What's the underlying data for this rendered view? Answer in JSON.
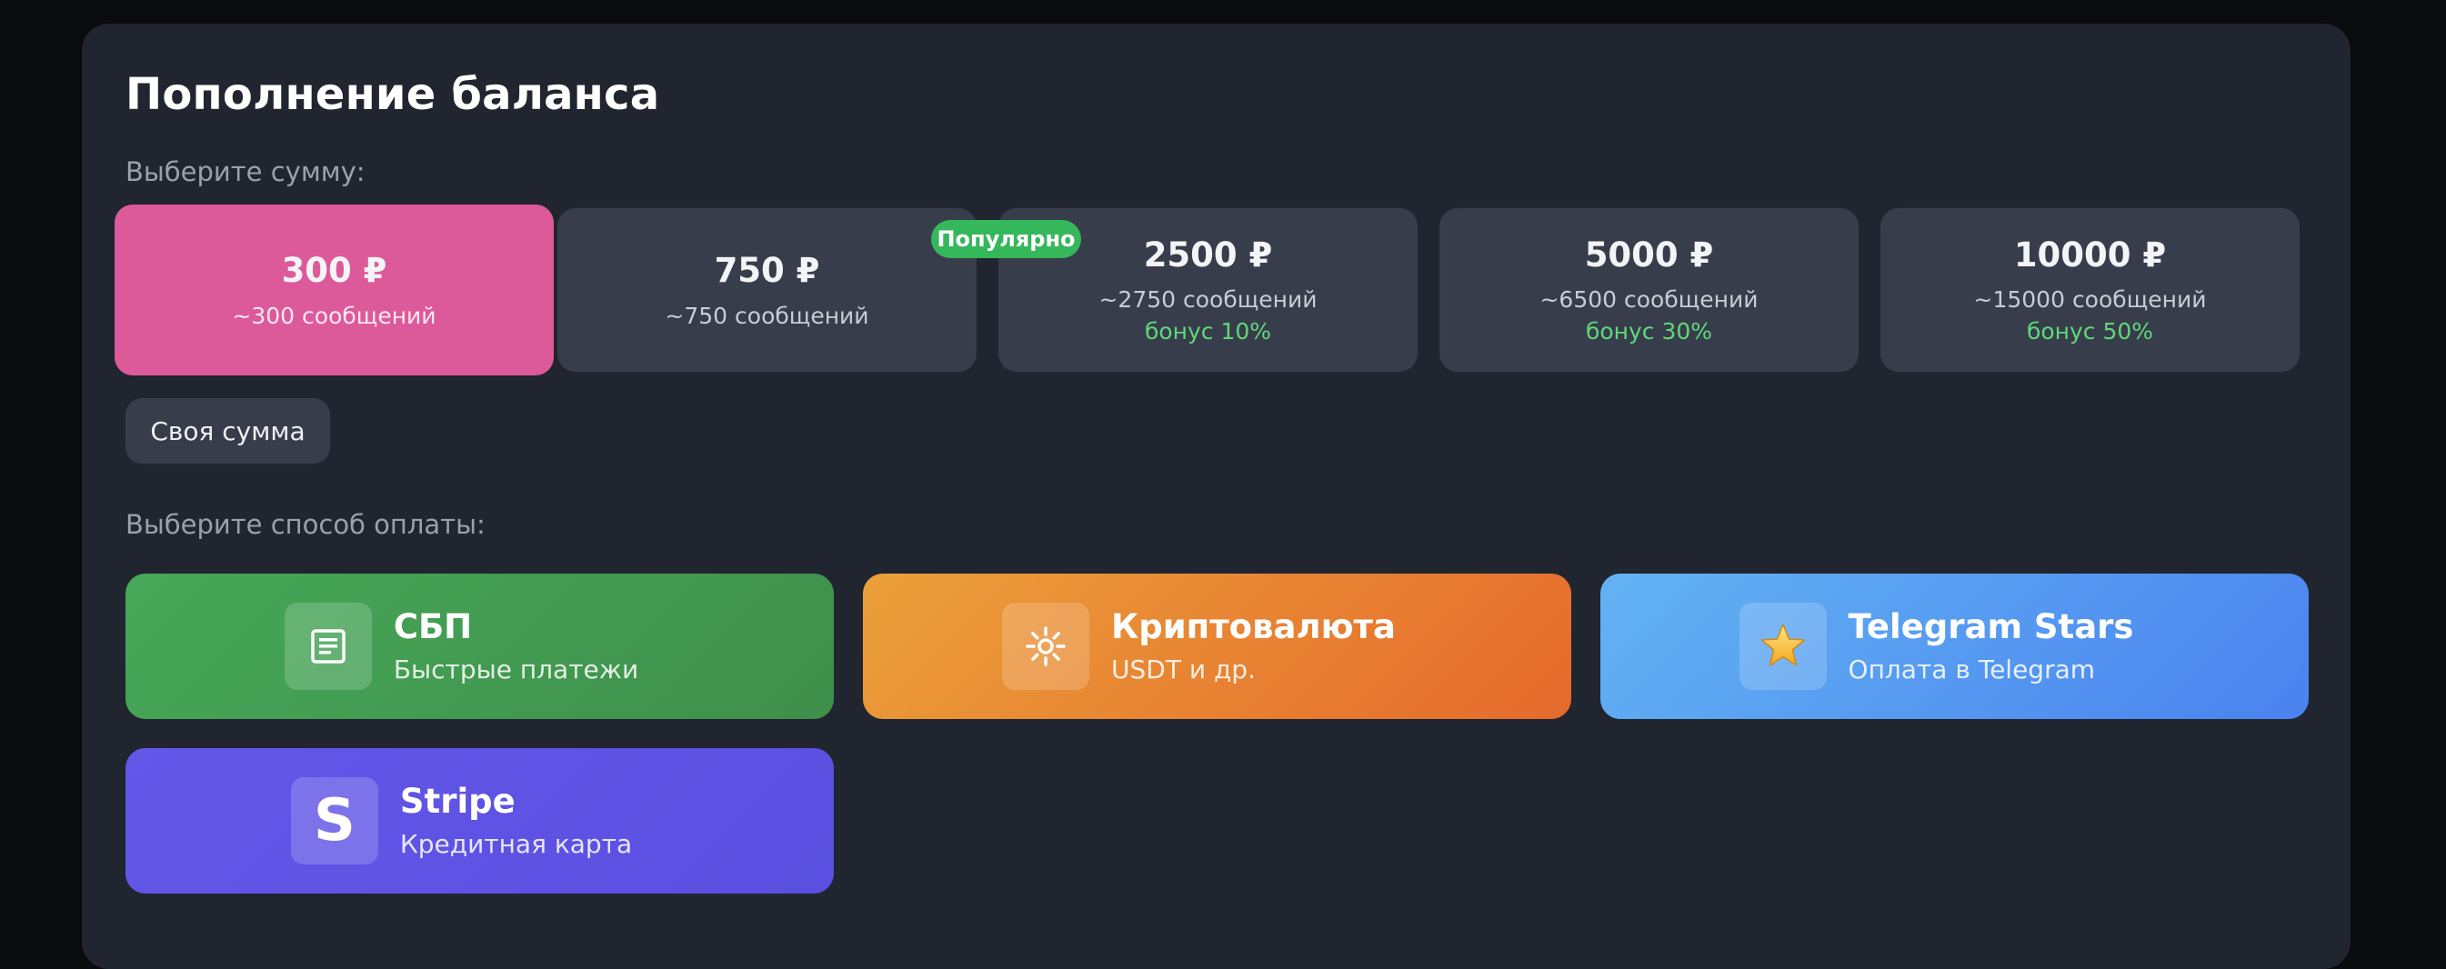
{
  "header": {
    "title": "Пополнение баланса"
  },
  "amount_section": {
    "label": "Выберите сумму:",
    "badge": "Популярно",
    "options": [
      {
        "value": "300 ₽",
        "messages": "~300 сообщений",
        "bonus": "",
        "selected": true
      },
      {
        "value": "750 ₽",
        "messages": "~750 сообщений",
        "bonus": "",
        "selected": false
      },
      {
        "value": "2500 ₽",
        "messages": "~2750 сообщений",
        "bonus": "бонус 10%",
        "selected": false
      },
      {
        "value": "5000 ₽",
        "messages": "~6500 сообщений",
        "bonus": "бонус 30%",
        "selected": false
      },
      {
        "value": "10000 ₽",
        "messages": "~15000 сообщений",
        "bonus": "бонус 50%",
        "selected": false
      }
    ],
    "custom_label": "Своя сумма"
  },
  "payment_section": {
    "label": "Выберите способ оплаты:",
    "methods": [
      {
        "title": "СБП",
        "subtitle": "Быстрые платежи",
        "icon": "receipt-icon",
        "color": "#46a858"
      },
      {
        "title": "Криптовалюта",
        "subtitle": "USDT и др.",
        "icon": "sun-icon",
        "color": "#eba03a"
      },
      {
        "title": "Telegram Stars",
        "subtitle": "Оплата в Telegram",
        "icon": "star-icon",
        "color": "#4a82ef"
      },
      {
        "title": "Stripe",
        "subtitle": "Кредитная карта",
        "icon": "stripe-logo-icon",
        "color": "#6357e8"
      }
    ]
  },
  "colors": {
    "background": "#0a0b0d",
    "panel": "#20252f",
    "card": "#383d4b",
    "selected": "#dd5a9a",
    "bonus": "#5fd87a",
    "badge": "#35b75b"
  }
}
